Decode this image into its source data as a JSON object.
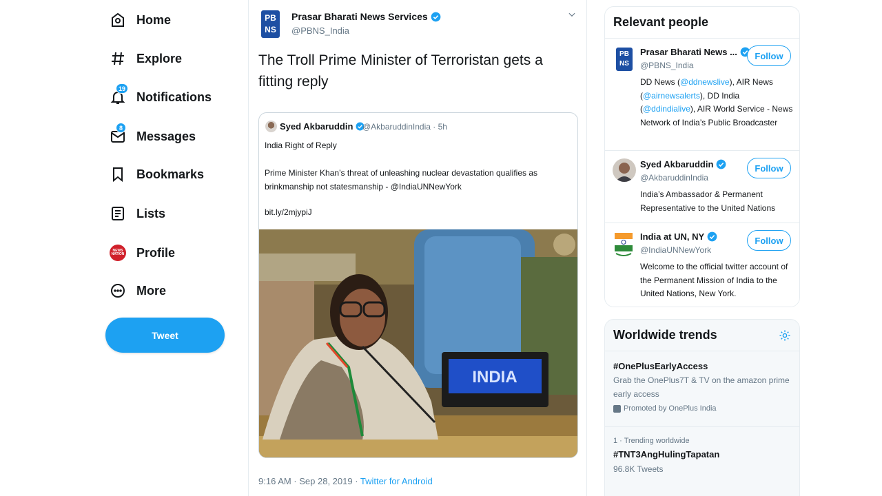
{
  "nav": {
    "items": [
      {
        "label": "Home",
        "icon": "home-icon"
      },
      {
        "label": "Explore",
        "icon": "hashtag-icon"
      },
      {
        "label": "Notifications",
        "icon": "bell-icon",
        "badge": "19"
      },
      {
        "label": "Messages",
        "icon": "envelope-icon",
        "badge": "8"
      },
      {
        "label": "Bookmarks",
        "icon": "bookmark-icon"
      },
      {
        "label": "Lists",
        "icon": "list-icon"
      },
      {
        "label": "Profile",
        "icon": "avatar-icon"
      },
      {
        "label": "More",
        "icon": "more-icon"
      }
    ],
    "tweet_button": "Tweet",
    "profile_avatar_text": [
      "NEWS",
      "NATION"
    ]
  },
  "tweet": {
    "author_avatar": [
      "PB",
      "NS"
    ],
    "author_name": "Prasar Bharati News Services",
    "author_handle": "@PBNS_India",
    "text": "The Troll Prime Minister of Terroristan gets a fitting reply",
    "timestamp": "9:16 AM · Sep 28, 2019 · ",
    "source_app": "Twitter for Android",
    "quote": {
      "name": "Syed Akbaruddin",
      "handle": "@AkbaruddinIndia · 5h",
      "line1": "India Right of Reply",
      "body": "Prime Minister Khan’s threat of unleashing nuclear devastation qualifies as brinkmanship not statesmanship - @IndiaUNNewYork",
      "link": "bit.ly/2mjypiJ",
      "image_sign": "INDIA"
    }
  },
  "relevant_people": {
    "title": "Relevant people",
    "follow_label": "Follow",
    "people": [
      {
        "name": "Prasar Bharati News ...",
        "handle": "@PBNS_India",
        "bio_parts": [
          "DD News (",
          "@ddnewslive",
          "), AIR News (",
          "@airnewsalerts",
          "), DD India (",
          "@ddindialive",
          "), AIR World Service - News Network of India’s Public Broadcaster"
        ],
        "avatar_text": [
          "PB",
          "NS"
        ]
      },
      {
        "name": "Syed Akbaruddin",
        "handle": "@AkbaruddinIndia",
        "bio": "India’s Ambassador & Permanent Representative to the United Nations"
      },
      {
        "name": "India at UN, NY",
        "handle": "@IndiaUNNewYork",
        "bio": "Welcome to the official twitter account of the Permanent Mission of India to the United Nations, New York."
      }
    ]
  },
  "trends": {
    "title": "Worldwide trends",
    "items": [
      {
        "title": "#OnePlusEarlyAccess",
        "desc": "Grab the OnePlus7T & TV on the amazon prime early access",
        "promoted": "Promoted by OnePlus India"
      },
      {
        "context": "1 · Trending worldwide",
        "title": "#TNT3AngHulingTapatan",
        "count": "96.8K Tweets"
      }
    ]
  },
  "colors": {
    "accent": "#1da1f2",
    "text": "#14171a",
    "muted": "#657786",
    "border": "#e6ecf0"
  }
}
